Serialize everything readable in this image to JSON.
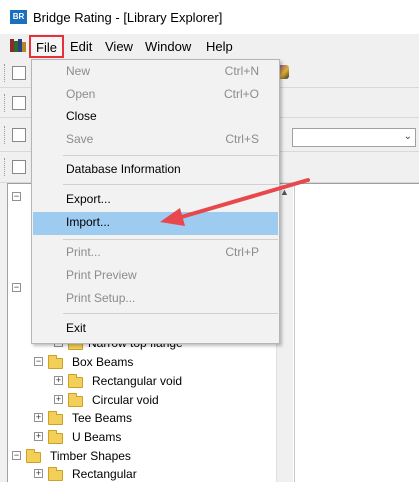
{
  "window": {
    "title": "Bridge Rating - [Library Explorer]",
    "icon_text": "BR"
  },
  "menubar": {
    "items": [
      {
        "label": "File"
      },
      {
        "label": "Edit"
      },
      {
        "label": "View"
      },
      {
        "label": "Window"
      },
      {
        "label": "Help"
      }
    ]
  },
  "file_menu": {
    "items": [
      {
        "label": "New",
        "shortcut": "Ctrl+N",
        "enabled": false
      },
      {
        "label": "Open",
        "shortcut": "Ctrl+O",
        "enabled": false
      },
      {
        "label": "Close",
        "shortcut": "",
        "enabled": true
      },
      {
        "label": "Save",
        "shortcut": "Ctrl+S",
        "enabled": false
      },
      {
        "label": "Database Information",
        "shortcut": "",
        "enabled": true
      },
      {
        "label": "Export...",
        "shortcut": "",
        "enabled": true
      },
      {
        "label": "Import...",
        "shortcut": "",
        "enabled": true,
        "highlighted": true
      },
      {
        "label": "Print...",
        "shortcut": "Ctrl+P",
        "enabled": false
      },
      {
        "label": "Print Preview",
        "shortcut": "",
        "enabled": false
      },
      {
        "label": "Print Setup...",
        "shortcut": "",
        "enabled": false
      },
      {
        "label": "Exit",
        "shortcut": "",
        "enabled": true
      }
    ]
  },
  "tree": {
    "items": [
      {
        "label": "Narrow top flange"
      },
      {
        "label": "Box Beams"
      },
      {
        "label": "Rectangular void"
      },
      {
        "label": "Circular void"
      },
      {
        "label": "Tee Beams"
      },
      {
        "label": "U Beams"
      },
      {
        "label": "Timber Shapes"
      },
      {
        "label": "Rectangular"
      }
    ]
  },
  "colors": {
    "highlight": "#9ecbf0",
    "focus_box": "#e8303a",
    "arrow": "#e8474c",
    "folder": "#f3cf5a"
  }
}
